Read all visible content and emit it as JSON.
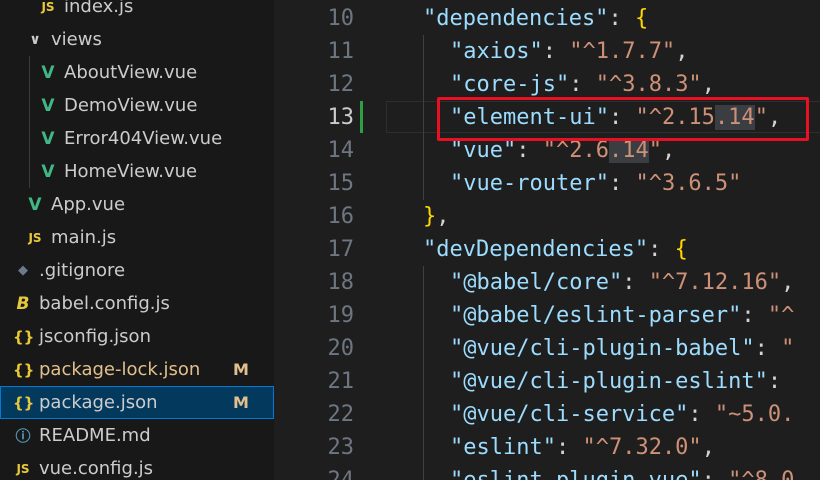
{
  "explorer": {
    "items": [
      {
        "name": "index.js",
        "icon": "js-icon",
        "icon_text": "JS",
        "indent": 1,
        "modified": false,
        "badge": ""
      },
      {
        "name": "views",
        "icon": "chevron-down-icon",
        "icon_text": "∨",
        "indent": 0,
        "modified": false,
        "badge": "",
        "folder": true
      },
      {
        "name": "AboutView.vue",
        "icon": "vue-icon",
        "icon_text": "V",
        "indent": 1,
        "modified": false,
        "badge": ""
      },
      {
        "name": "DemoView.vue",
        "icon": "vue-icon",
        "icon_text": "V",
        "indent": 1,
        "modified": false,
        "badge": ""
      },
      {
        "name": "Error404View.vue",
        "icon": "vue-icon",
        "icon_text": "V",
        "indent": 1,
        "modified": false,
        "badge": ""
      },
      {
        "name": "HomeView.vue",
        "icon": "vue-icon",
        "icon_text": "V",
        "indent": 1,
        "modified": false,
        "badge": ""
      },
      {
        "name": "App.vue",
        "icon": "vue-icon",
        "icon_text": "V",
        "indent": 0,
        "modified": false,
        "badge": ""
      },
      {
        "name": "main.js",
        "icon": "js-icon",
        "icon_text": "JS",
        "indent": 0,
        "modified": false,
        "badge": ""
      },
      {
        "name": ".gitignore",
        "icon": "git-icon",
        "icon_text": "◆",
        "indent": -1,
        "modified": false,
        "badge": ""
      },
      {
        "name": "babel.config.js",
        "icon": "babel-icon",
        "icon_text": "B",
        "indent": -1,
        "modified": false,
        "badge": ""
      },
      {
        "name": "jsconfig.json",
        "icon": "json-icon",
        "icon_text": "{}",
        "indent": -1,
        "modified": false,
        "badge": ""
      },
      {
        "name": "package-lock.json",
        "icon": "json-icon",
        "icon_text": "{}",
        "indent": -1,
        "modified": true,
        "badge": "M"
      },
      {
        "name": "package.json",
        "icon": "json-icon",
        "icon_text": "{}",
        "indent": -1,
        "modified": false,
        "badge": "M",
        "selected": true
      },
      {
        "name": "README.md",
        "icon": "info-icon",
        "icon_text": "ⓘ",
        "indent": -1,
        "modified": false,
        "badge": ""
      },
      {
        "name": "vue.config.js",
        "icon": "js-icon",
        "icon_text": "JS",
        "indent": -1,
        "modified": false,
        "badge": ""
      }
    ]
  },
  "editor": {
    "active_line": "13",
    "lines": [
      {
        "num": "10",
        "tokens": [
          {
            "t": "\"dependencies\"",
            "c": "k"
          },
          {
            "t": ": ",
            "c": "p"
          },
          {
            "t": "{",
            "c": "b1"
          }
        ],
        "indent": 0
      },
      {
        "num": "11",
        "tokens": [
          {
            "t": "\"axios\"",
            "c": "k"
          },
          {
            "t": ": ",
            "c": "p"
          },
          {
            "t": "\"^1.7.7\"",
            "c": "s"
          },
          {
            "t": ",",
            "c": "p"
          }
        ],
        "indent": 1
      },
      {
        "num": "12",
        "tokens": [
          {
            "t": "\"core-js\"",
            "c": "k"
          },
          {
            "t": ": ",
            "c": "p"
          },
          {
            "t": "\"^3.8.3\"",
            "c": "s"
          },
          {
            "t": ",",
            "c": "p"
          }
        ],
        "indent": 1
      },
      {
        "num": "13",
        "tokens": [
          {
            "t": "\"element-ui\"",
            "c": "k"
          },
          {
            "t": ": ",
            "c": "p"
          },
          {
            "t": "\"^2.15",
            "c": "s"
          },
          {
            "t": ".14",
            "c": "s hl"
          },
          {
            "t": "\"",
            "c": "s"
          },
          {
            "t": ",",
            "c": "p"
          }
        ],
        "indent": 1
      },
      {
        "num": "14",
        "tokens": [
          {
            "t": "\"vue\"",
            "c": "k"
          },
          {
            "t": ": ",
            "c": "p"
          },
          {
            "t": "\"^2.6",
            "c": "s"
          },
          {
            "t": ".14",
            "c": "s hl"
          },
          {
            "t": "\"",
            "c": "s"
          },
          {
            "t": ",",
            "c": "p"
          }
        ],
        "indent": 1
      },
      {
        "num": "15",
        "tokens": [
          {
            "t": "\"vue-router\"",
            "c": "k"
          },
          {
            "t": ": ",
            "c": "p"
          },
          {
            "t": "\"^3.6.5\"",
            "c": "s"
          }
        ],
        "indent": 1
      },
      {
        "num": "16",
        "tokens": [
          {
            "t": "}",
            "c": "b1"
          },
          {
            "t": ",",
            "c": "p"
          }
        ],
        "indent": 0
      },
      {
        "num": "17",
        "tokens": [
          {
            "t": "\"devDependencies\"",
            "c": "k"
          },
          {
            "t": ": ",
            "c": "p"
          },
          {
            "t": "{",
            "c": "b1"
          }
        ],
        "indent": 0
      },
      {
        "num": "18",
        "tokens": [
          {
            "t": "\"@babel/core\"",
            "c": "k"
          },
          {
            "t": ": ",
            "c": "p"
          },
          {
            "t": "\"^7.12.16\"",
            "c": "s"
          },
          {
            "t": ",",
            "c": "p"
          }
        ],
        "indent": 1
      },
      {
        "num": "19",
        "tokens": [
          {
            "t": "\"@babel/eslint-parser\"",
            "c": "k"
          },
          {
            "t": ": ",
            "c": "p"
          },
          {
            "t": "\"^",
            "c": "s"
          }
        ],
        "indent": 1
      },
      {
        "num": "20",
        "tokens": [
          {
            "t": "\"@vue/cli-plugin-babel\"",
            "c": "k"
          },
          {
            "t": ": ",
            "c": "p"
          },
          {
            "t": "\"",
            "c": "s"
          }
        ],
        "indent": 1
      },
      {
        "num": "21",
        "tokens": [
          {
            "t": "\"@vue/cli-plugin-eslint\"",
            "c": "k"
          },
          {
            "t": ": ",
            "c": "p"
          }
        ],
        "indent": 1
      },
      {
        "num": "22",
        "tokens": [
          {
            "t": "\"@vue/cli-service\"",
            "c": "k"
          },
          {
            "t": ": ",
            "c": "p"
          },
          {
            "t": "\"~5.0.",
            "c": "s"
          }
        ],
        "indent": 1
      },
      {
        "num": "23",
        "tokens": [
          {
            "t": "\"eslint\"",
            "c": "k"
          },
          {
            "t": ": ",
            "c": "p"
          },
          {
            "t": "\"^7.32.0\"",
            "c": "s"
          },
          {
            "t": ",",
            "c": "p"
          }
        ],
        "indent": 1
      },
      {
        "num": "24",
        "tokens": [
          {
            "t": "\"eslint-plugin-vue\"",
            "c": "k"
          },
          {
            "t": ": ",
            "c": "p"
          },
          {
            "t": "\"^8.0",
            "c": "s"
          }
        ],
        "indent": 1
      }
    ]
  },
  "colors": {
    "selection_bg": "#04395e",
    "highlight_border": "#e81123",
    "git_added": "#2ea043"
  }
}
